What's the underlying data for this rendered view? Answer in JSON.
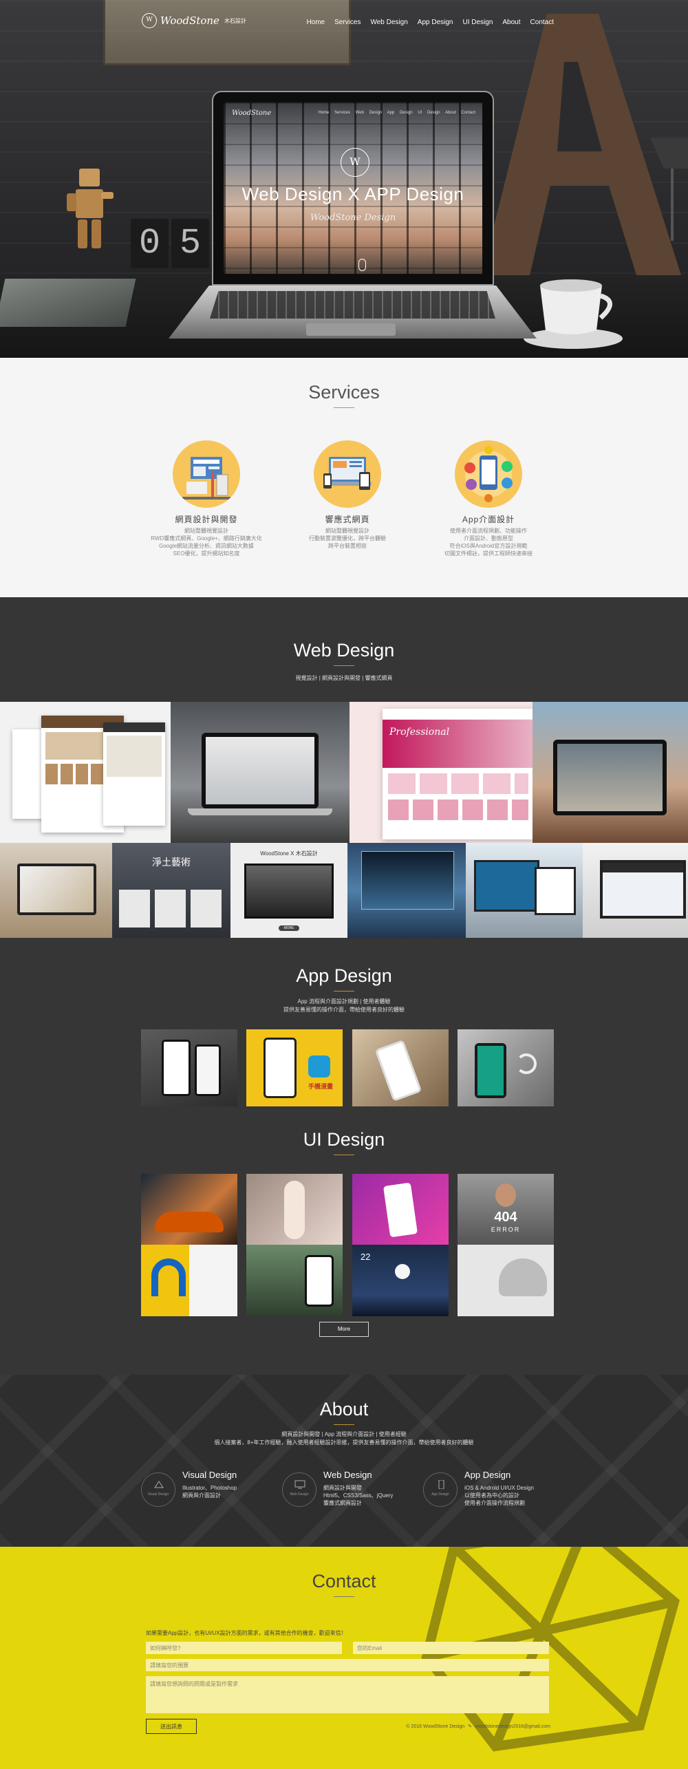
{
  "header": {
    "brand_mark": "W",
    "brand_name": "WoodStone",
    "brand_cn": "木石設計",
    "nav": [
      "Home",
      "Services",
      "Web Design",
      "App Design",
      "UI Design",
      "About",
      "Contact"
    ]
  },
  "hero": {
    "clock_digits": [
      "0",
      "5"
    ],
    "screen_logo": "WoodStone",
    "screen_nav": "Home Services Web Design App Design UI Design About Contact",
    "emblem": "W",
    "title": "Web Design  X  APP Design",
    "subtitle": "WoodStone Design"
  },
  "services": {
    "title": "Services",
    "items": [
      {
        "title": "網頁設計與開發",
        "desc": "網站整體視覺設計\nRWD響應式網頁、Google+、網路行銷廣大化\nGoogle網站流量分析、資訊網站大數據\nSEO優化，提升網站知名度",
        "icon": "website-builder-icon"
      },
      {
        "title": "響應式網頁",
        "desc": "網站整體視覺設計\n行動裝置瀏覽優化，跨平台體驗\n跨平台裝置相容",
        "icon": "responsive-devices-icon"
      },
      {
        "title": "App介面設計",
        "desc": "使用者介面流程規劃、功能操作\n介面設計、動態原型\n符合iOS與Android官方設計規範\n切圖文件標註，提供工程師快速串接",
        "icon": "app-interface-icon"
      }
    ]
  },
  "web_design": {
    "title": "Web Design",
    "subtitle": "視覺設計 | 網頁設計與開發 | 響應式網頁",
    "tiles": [
      {
        "label": "Professional"
      },
      {
        "label": "淨土藝術"
      },
      {
        "label": "WoodStone X 木石設計"
      },
      {
        "label": "MORE"
      }
    ]
  },
  "app_design": {
    "title": "App Design",
    "subtitle": "App 流程與介面設計規劃 | 使用者體驗\n提供友善易懂的操作介面，帶給使用者良好的體驗",
    "thumbs": [
      {
        "label": "app-screenshot-1"
      },
      {
        "label": "手機漫畫"
      },
      {
        "label": "app-screenshot-3"
      },
      {
        "label": "app-screenshot-4"
      }
    ]
  },
  "ui_design": {
    "title": "UI Design",
    "badge_404": "404",
    "badge_error": "ERROR",
    "clock_22": "22",
    "more_label": "More"
  },
  "about": {
    "title": "About",
    "line1": "網頁設計與開發 | App 流程與介面設計 | 使用者經驗",
    "line2": "個人接案者，8+年工作經驗，融入使用者經驗設計思維，提供友善易懂的操作介面，帶給使用者良好的體驗",
    "cols": [
      {
        "ring": "Visual Design",
        "title": "Visual Design",
        "desc": "Illustrator、Photoshop\n網頁與介面設計",
        "icon": "visual-design-icon"
      },
      {
        "ring": "Web Design",
        "title": "Web Design",
        "desc": "網頁設計與開發\nHtml5、CSS3/Sass、jQuery\n響應式網頁設計",
        "icon": "web-design-icon"
      },
      {
        "ring": "App Design",
        "title": "App Design",
        "desc": "iOS & Android UI/UX Design\n以使用者為中心的設計\n使用者介面操作流程規劃",
        "icon": "app-design-icon"
      }
    ]
  },
  "contact": {
    "title": "Contact",
    "intro": "如果需要App設計，也有UI/UX設計方面的需求，或有其他合作的機會，歡迎來信！",
    "name_placeholder": "如何稱呼您?",
    "email_placeholder": "您的Email",
    "budget_placeholder": "請填寫您的預算",
    "message_placeholder": "請填寫您想詢問的問題或是製作需求",
    "send_label": "送出訊息",
    "copyright": "© 2016 WoodStone Design",
    "email": "woodstonedesign2016@gmail.com"
  },
  "colors": {
    "accent": "#c58f3a",
    "contact_bg": "#e3d60a",
    "dark_bg": "#363636",
    "services_bg": "#f5f5f5",
    "service_icon_bg": "#f7c55a"
  }
}
